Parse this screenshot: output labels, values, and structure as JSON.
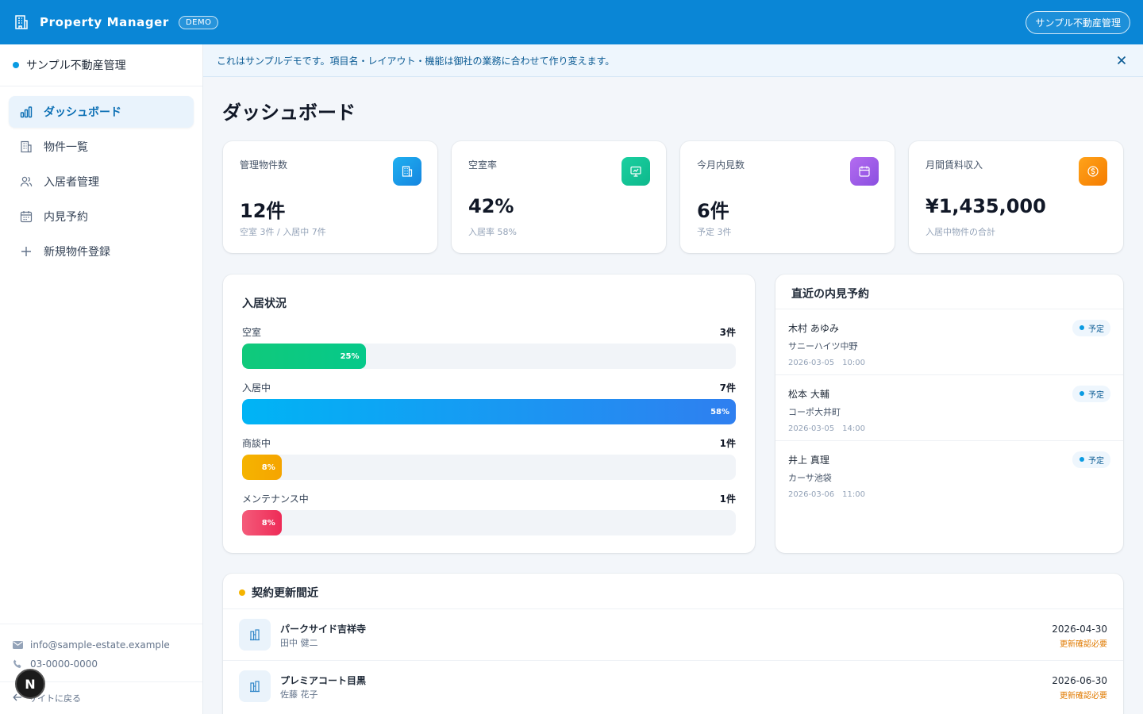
{
  "header": {
    "app_title": "Property Manager",
    "demo_badge": "DEMO",
    "company": "サンプル不動産管理"
  },
  "sidebar": {
    "company": "サンプル不動産管理",
    "items": [
      {
        "label": "ダッシュボード",
        "icon": "bar-chart-icon",
        "active": true
      },
      {
        "label": "物件一覧",
        "icon": "building-icon",
        "active": false
      },
      {
        "label": "入居者管理",
        "icon": "users-icon",
        "active": false
      },
      {
        "label": "内見予約",
        "icon": "calendar-icon",
        "active": false
      },
      {
        "label": "新規物件登録",
        "icon": "plus-icon",
        "active": false
      }
    ],
    "email": "info@sample-estate.example",
    "phone": "03-0000-0000",
    "back_label": "サイトに戻る"
  },
  "notice": {
    "text": "これはサンプルデモです。項目名・レイアウト・機能は御社の業務に合わせて作り変えます。"
  },
  "page_title": "ダッシュボード",
  "stats": [
    {
      "label": "管理物件数",
      "value": "12件",
      "sub": "空室 3件 / 入居中 7件",
      "icon": "building-icon",
      "color": "#1a9be8"
    },
    {
      "label": "空室率",
      "value": "42%",
      "sub": "入居率 58%",
      "icon": "presentation-icon",
      "color": "#12c49a"
    },
    {
      "label": "今月内見数",
      "value": "6件",
      "sub": "予定 3件",
      "icon": "calendar-icon",
      "color": "#9b5de5"
    },
    {
      "label": "月間賃料収入",
      "value": "¥1,435,000",
      "sub": "入居中物件の合計",
      "icon": "coin-icon",
      "color": "#f79009"
    }
  ],
  "occupancy": {
    "title": "入居状況",
    "rows": [
      {
        "label": "空室",
        "count": "3件",
        "percent": 25,
        "percent_label": "25%",
        "color_from": "#10c97b",
        "color_to": "#06c98a"
      },
      {
        "label": "入居中",
        "count": "7件",
        "percent": 100,
        "percent_label": "58%",
        "color_from": "#00b4f5",
        "color_to": "#2f7ff0"
      },
      {
        "label": "商談中",
        "count": "1件",
        "percent": 8,
        "percent_label": "8%",
        "color_from": "#f5b400",
        "color_to": "#f5a400"
      },
      {
        "label": "メンテナンス中",
        "count": "1件",
        "percent": 8,
        "percent_label": "8%",
        "color_from": "#f45b7a",
        "color_to": "#ee2b57"
      }
    ]
  },
  "visits": {
    "title": "直近の内見予約",
    "items": [
      {
        "name": "木村 あゆみ",
        "property": "サニーハイツ中野",
        "datetime": "2026-03-05　10:00",
        "status": "予定"
      },
      {
        "name": "松本 大輔",
        "property": "コーポ大井町",
        "datetime": "2026-03-05　14:00",
        "status": "予定"
      },
      {
        "name": "井上 真理",
        "property": "カーサ池袋",
        "datetime": "2026-03-06　11:00",
        "status": "予定"
      }
    ]
  },
  "renewals": {
    "title": "契約更新間近",
    "items": [
      {
        "property": "パークサイド吉祥寺",
        "tenant": "田中 健二",
        "date": "2026-04-30",
        "note": "更新確認必要"
      },
      {
        "property": "プレミアコート目黒",
        "tenant": "佐藤 花子",
        "date": "2026-06-30",
        "note": "更新確認必要"
      }
    ]
  }
}
